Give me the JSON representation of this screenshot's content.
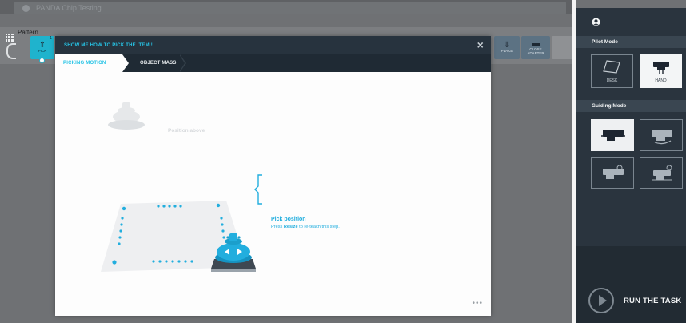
{
  "background": {
    "task_bar_text": "PANDA Chip Testing",
    "pattern_label": "Pattern",
    "tiles": {
      "pick": {
        "label": "PICK",
        "badge": "1"
      },
      "place": {
        "label": "PLACE"
      },
      "adapter": {
        "label": "CLOSE ADAPTER"
      }
    }
  },
  "modal": {
    "title": "SHOW ME HOW TO PICK THE ITEM !",
    "close_glyph": "×",
    "tabs": [
      {
        "label": "PICKING MOTION",
        "active": true
      },
      {
        "label": "OBJECT MASS",
        "active": false
      }
    ],
    "scene": {
      "position_above_label": "Position above",
      "pick_title": "Pick position",
      "pick_body_prefix": "Press ",
      "pick_body_bold": "Resize",
      "pick_body_suffix": " to re-teach this step."
    },
    "more_glyph": "•••"
  },
  "panel": {
    "pilot_mode_header": "Pilot Mode",
    "pilot_modes": [
      {
        "label": "DESK",
        "selected": false
      },
      {
        "label": "HAND",
        "selected": true
      }
    ],
    "guiding_mode_header": "Guiding Mode",
    "guiding_modes_selected_index": 0,
    "run_label": "RUN THE TASK"
  },
  "colors": {
    "accent": "#27c4e6",
    "modal_header": "#27333e",
    "panel_bg": "#2a343e"
  },
  "icons": {
    "grid": "grid-icon",
    "close": "close-icon",
    "avatar": "user-icon",
    "run": "play-icon"
  }
}
